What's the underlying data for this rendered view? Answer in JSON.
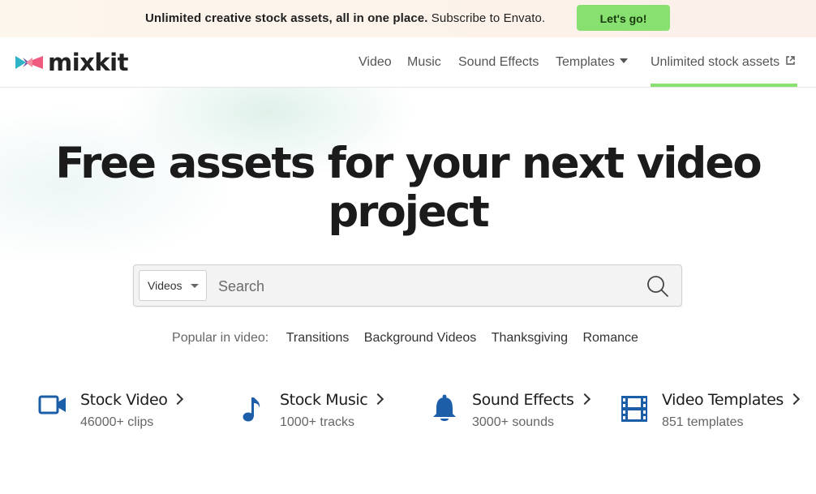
{
  "promo": {
    "bold_text": "Unlimited creative stock assets, all in one place.",
    "text": "Subscribe to Envato.",
    "button_label": "Let's go!"
  },
  "header": {
    "logo_text": "mixkit",
    "nav": [
      {
        "label": "Video"
      },
      {
        "label": "Music"
      },
      {
        "label": "Sound Effects"
      },
      {
        "label": "Templates"
      },
      {
        "label": "Unlimited stock assets"
      }
    ]
  },
  "hero": {
    "title_line1": "Free assets for your next video",
    "title_line2": "project"
  },
  "search": {
    "category_value": "Videos",
    "placeholder": "Search"
  },
  "popular": {
    "label": "Popular in video:",
    "tags": [
      "Transitions",
      "Background Videos",
      "Thanksgiving",
      "Romance"
    ]
  },
  "categories": [
    {
      "title": "Stock Video",
      "subtitle": "46000+ clips",
      "icon": "video-camera-icon"
    },
    {
      "title": "Stock Music",
      "subtitle": "1000+ tracks",
      "icon": "music-note-icon"
    },
    {
      "title": "Sound Effects",
      "subtitle": "3000+ sounds",
      "icon": "bell-icon"
    },
    {
      "title": "Video Templates",
      "subtitle": "851 templates",
      "icon": "film-strip-icon"
    }
  ],
  "colors": {
    "accent_green": "#87e06f",
    "icon_blue": "#1c5fa8",
    "text_dark": "#1b1b1b"
  }
}
